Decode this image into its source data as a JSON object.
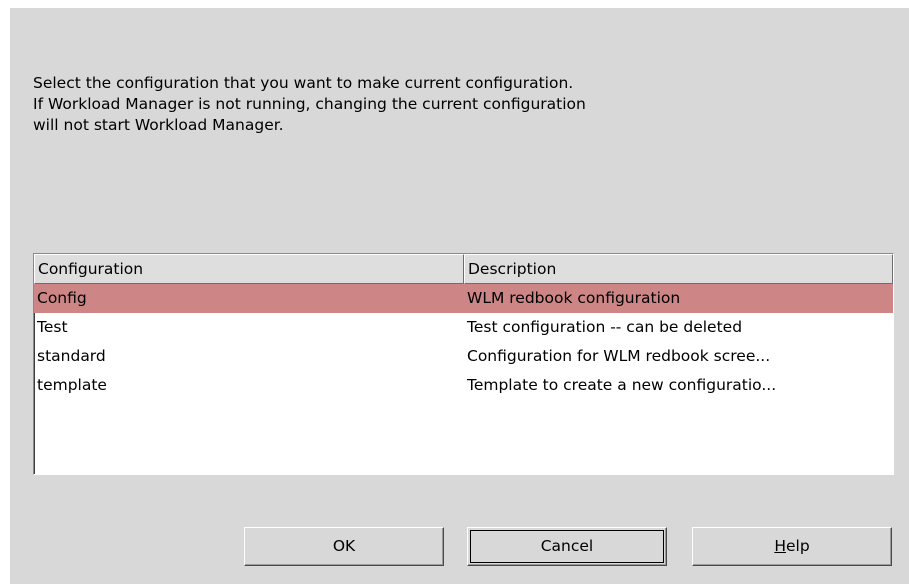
{
  "message": {
    "lines": [
      "Select the configuration that you want to make current configuration.",
      "If Workload Manager is not running, changing the current configuration",
      "will not start Workload Manager."
    ]
  },
  "table": {
    "columns": [
      "Configuration",
      "Description"
    ],
    "rows": [
      {
        "configuration": "Config",
        "description": "WLM redbook configuration",
        "selected": true
      },
      {
        "configuration": "Test",
        "description": "Test configuration -- can be deleted",
        "selected": false
      },
      {
        "configuration": "standard",
        "description": "Configuration for WLM redbook scree...",
        "selected": false
      },
      {
        "configuration": "template",
        "description": "Template to create a new configuratio...",
        "selected": false
      }
    ],
    "selection_color": "#cd8585"
  },
  "buttons": {
    "ok_label": "OK",
    "cancel_label": "Cancel",
    "help_mnemonic": "H",
    "help_rest": "elp"
  }
}
